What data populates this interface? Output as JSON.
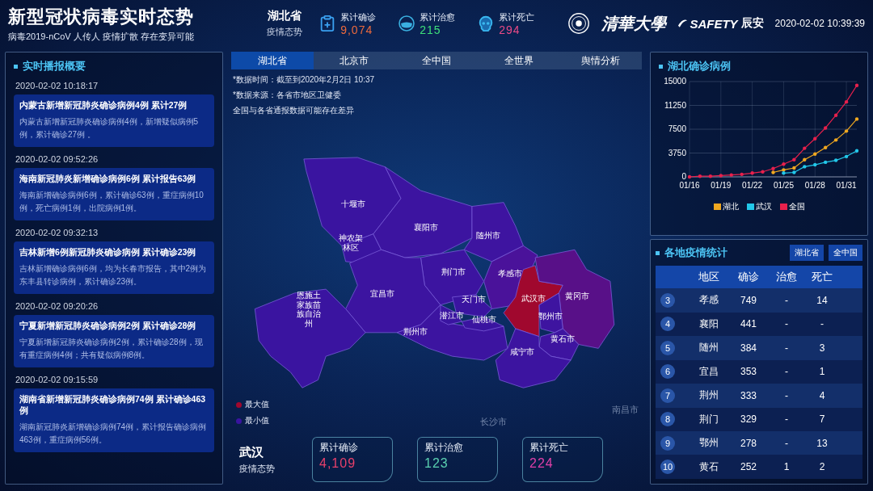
{
  "header": {
    "title": "新型冠状病毒实时态势",
    "subtitle": "病毒2019-nCoV 人传人 疫情扩散 存在变异可能",
    "region": {
      "name": "湖北省",
      "caption": "疫情态势"
    },
    "stats": [
      {
        "kind": "confirmed",
        "label": "累计确诊",
        "value": "9,074",
        "color": "#ee6a3c"
      },
      {
        "kind": "cured",
        "label": "累计治愈",
        "value": "215",
        "color": "#3ee07a"
      },
      {
        "kind": "dead",
        "label": "累计死亡",
        "value": "294",
        "color": "#ea4a86"
      }
    ],
    "logos": [
      "清華大學",
      "SAFETY",
      "辰安"
    ],
    "datetime": "2020-02-02 10:39:39"
  },
  "news": {
    "title": "实时播报概要",
    "items": [
      {
        "time": "2020-02-02 10:18:17",
        "headline": "内蒙古新增新冠肺炎确诊病例4例 累计27例",
        "body": "内蒙古新增新冠肺炎确诊病例4例，新增疑似病例5例，累计确诊27例 。"
      },
      {
        "time": "2020-02-02 09:52:26",
        "headline": "海南新冠肺炎新增确诊病例6例 累计报告63例",
        "body": "海南新增确诊病例6例，累计确诊63例，重症病例10例，死亡病例1例，出院病例1例。"
      },
      {
        "time": "2020-02-02 09:32:13",
        "headline": "吉林新增6例新冠肺炎确诊病例 累计确诊23例",
        "body": "吉林新增确诊病例6例，均为长春市报告，其中2例为东丰县转诊病例，累计确诊23例。"
      },
      {
        "time": "2020-02-02 09:20:26",
        "headline": "宁夏新增新冠肺炎确诊病例2例 累计确诊28例",
        "body": "宁夏新增新冠肺炎确诊病例2例，累计确诊28例，现有重症病例4例；共有疑似病例8例。"
      },
      {
        "time": "2020-02-02 09:15:59",
        "headline": "湖南省新增新冠肺炎确诊病例74例 累计确诊463例",
        "body": "湖南新冠肺炎新增确诊病例74例，累计报告确诊病例463例，重症病例56例。"
      }
    ]
  },
  "tabs": [
    {
      "label": "湖北省",
      "selected": true
    },
    {
      "label": "北京市",
      "selected": false
    },
    {
      "label": "全中国",
      "selected": false
    },
    {
      "label": "全世界",
      "selected": false
    },
    {
      "label": "舆情分析",
      "selected": false
    }
  ],
  "notes": [
    "*数据时间：截至到2020年2月2日 10:37",
    "*数据来源：各省市地区卫健委",
    "全国与各省通报数据可能存在差异"
  ],
  "map": {
    "regions": [
      {
        "name": "十堰市",
        "color": "#3a14a0"
      },
      {
        "name": "襄阳市",
        "color": "#3c14a0"
      },
      {
        "name": "随州市",
        "color": "#3e14a0"
      },
      {
        "name": "神农架林区",
        "color": "#3a14a0"
      },
      {
        "name": "荆门市",
        "color": "#3c14a0"
      },
      {
        "name": "孝感市",
        "color": "#4a129a"
      },
      {
        "name": "恩施土家族苗族自治州",
        "color": "#3a14a0"
      },
      {
        "name": "宜昌市",
        "color": "#3c14a0"
      },
      {
        "name": "天门市",
        "color": "#3a14a0"
      },
      {
        "name": "武汉市",
        "color": "#a0082e"
      },
      {
        "name": "黄冈市",
        "color": "#581088"
      },
      {
        "name": "潜江市",
        "color": "#3a14a0"
      },
      {
        "name": "仙桃市",
        "color": "#3a14a0"
      },
      {
        "name": "鄂州市",
        "color": "#3e14a0"
      },
      {
        "name": "荆州市",
        "color": "#3c14a0"
      },
      {
        "name": "黄石市",
        "color": "#3e14a0"
      },
      {
        "name": "咸宁市",
        "color": "#3c14a0"
      }
    ],
    "background_labels": [
      "长沙市",
      "南昌市"
    ],
    "legend": [
      {
        "label": "最大值",
        "color": "#a0082e"
      },
      {
        "label": "最小值",
        "color": "#3a14a0"
      }
    ]
  },
  "city": {
    "name": "武汉",
    "caption": "疫情态势",
    "stats": [
      {
        "label": "累计确诊",
        "value": "4,109",
        "color": "#e8406a"
      },
      {
        "label": "累计治愈",
        "value": "123",
        "color": "#5ad0b0"
      },
      {
        "label": "累计死亡",
        "value": "224",
        "color": "#e040a8"
      }
    ]
  },
  "trend": {
    "title": "湖北确诊病例",
    "chart_data": {
      "type": "line",
      "categories": [
        "01/16",
        null,
        null,
        "01/19",
        null,
        null,
        "01/22",
        null,
        null,
        "01/25",
        null,
        null,
        "01/28",
        null,
        null,
        "01/31",
        null
      ],
      "grid": true,
      "series": [
        {
          "name": "湖北",
          "color": "#f0a820",
          "values": [
            null,
            null,
            null,
            null,
            null,
            null,
            null,
            null,
            700,
            1100,
            1400,
            2700,
            3600,
            4600,
            5800,
            7200,
            9100
          ]
        },
        {
          "name": "武汉",
          "color": "#22c8ea",
          "values": [
            null,
            null,
            null,
            null,
            null,
            null,
            null,
            null,
            null,
            600,
            700,
            1600,
            1900,
            2300,
            2600,
            3200,
            4100
          ]
        },
        {
          "name": "全国",
          "color": "#e8204c",
          "values": [
            0,
            100,
            100,
            200,
            300,
            400,
            600,
            800,
            1300,
            2000,
            2700,
            4500,
            6000,
            7700,
            9700,
            11800,
            14400
          ]
        }
      ],
      "ylim": [
        0,
        15000
      ],
      "yticks": [
        0,
        3750,
        7500,
        11250,
        15000
      ]
    }
  },
  "stats_table": {
    "title": "各地疫情统计",
    "buttons": [
      "湖北省",
      "全中国"
    ],
    "columns": [
      "地区",
      "确诊",
      "治愈",
      "死亡"
    ],
    "rows": [
      {
        "rank": "3",
        "region": "孝感",
        "confirmed": "749",
        "cured": "-",
        "dead": "14"
      },
      {
        "rank": "4",
        "region": "襄阳",
        "confirmed": "441",
        "cured": "-",
        "dead": "-"
      },
      {
        "rank": "5",
        "region": "随州",
        "confirmed": "384",
        "cured": "-",
        "dead": "3"
      },
      {
        "rank": "6",
        "region": "宜昌",
        "confirmed": "353",
        "cured": "-",
        "dead": "1"
      },
      {
        "rank": "7",
        "region": "荆州",
        "confirmed": "333",
        "cured": "-",
        "dead": "4"
      },
      {
        "rank": "8",
        "region": "荆门",
        "confirmed": "329",
        "cured": "-",
        "dead": "7"
      },
      {
        "rank": "9",
        "region": "鄂州",
        "confirmed": "278",
        "cured": "-",
        "dead": "13"
      },
      {
        "rank": "10",
        "region": "黄石",
        "confirmed": "252",
        "cured": "1",
        "dead": "2"
      }
    ]
  }
}
